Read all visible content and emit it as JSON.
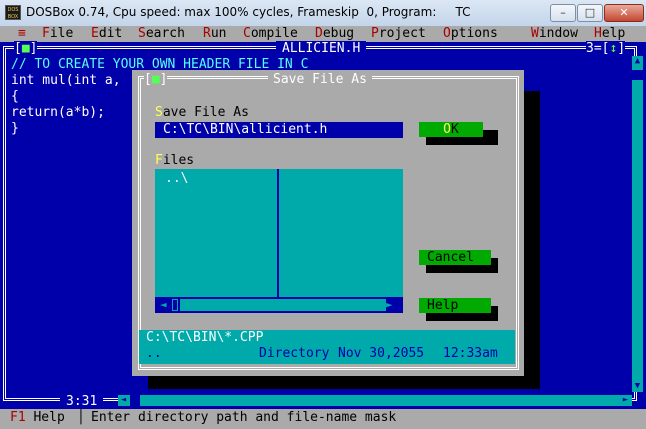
{
  "window": {
    "title": "DOSBox 0.74, Cpu speed: max 100% cycles, Frameskip  0, Program:     TC",
    "icon_text": "DOS BOX",
    "controls": {
      "minimize": "–",
      "maximize": "□",
      "close": "✕"
    }
  },
  "menu": {
    "system": "≡",
    "items": [
      {
        "hotkey": "F",
        "rest": "ile"
      },
      {
        "hotkey": "E",
        "rest": "dit"
      },
      {
        "hotkey": "S",
        "rest": "earch"
      },
      {
        "hotkey": "R",
        "rest": "un"
      },
      {
        "hotkey": "C",
        "rest": "ompile"
      },
      {
        "hotkey": "D",
        "rest": "ebug"
      },
      {
        "hotkey": "P",
        "rest": "roject"
      },
      {
        "hotkey": "O",
        "rest": "ptions"
      },
      {
        "hotkey": "W",
        "rest": "indow"
      },
      {
        "hotkey": "H",
        "rest": "elp"
      }
    ]
  },
  "editor": {
    "filename": "ALLICIEN.H",
    "close_box": "■",
    "window_number": "3",
    "zoom_box": "↕",
    "lines": [
      "// TO CREATE YOUR OWN HEADER FILE IN C",
      "int mul(int a,",
      "{",
      "return(a*b);",
      "}"
    ],
    "cursor_position": "3:31"
  },
  "dialog": {
    "title": "Save File As",
    "close_box": "■",
    "input_label_hotkey": "S",
    "input_label_rest": "ave File As",
    "input_value": "C:\\TC\\BIN\\allicient.h",
    "files_label_hotkey": "F",
    "files_label_rest": "iles",
    "files": [
      "..\\"
    ],
    "buttons": {
      "ok": {
        "hotkey": "O",
        "rest": "K"
      },
      "cancel": {
        "label": "Cancel"
      },
      "help": {
        "label": "Help"
      }
    },
    "info_path": "C:\\TC\\BIN\\*.CPP",
    "info_name": "..",
    "info_type": "Directory",
    "info_date": "Nov 30,2055",
    "info_time": "12:33am"
  },
  "status": {
    "key": "F1",
    "key_label": "Help",
    "separator": "│",
    "message": "Enter directory path and file-name mask"
  },
  "colors": {
    "desktop": "#0000aa",
    "menu": "#aaaaaa",
    "dialog": "#aaaaaa",
    "list": "#00aaaa",
    "button": "#00aa00",
    "hotkey_menu": "#aa0000",
    "hotkey_dialog": "#ffff55"
  }
}
